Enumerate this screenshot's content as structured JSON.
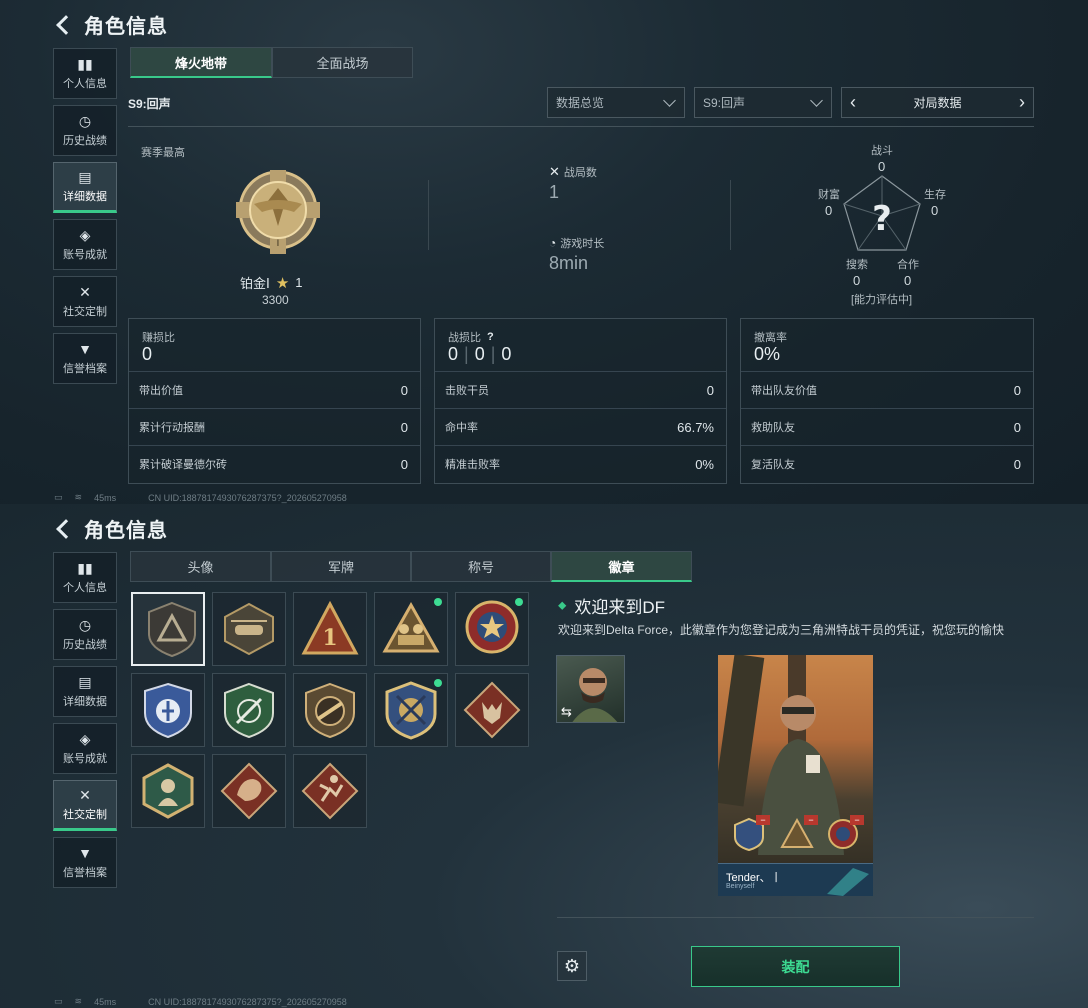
{
  "screen1": {
    "title": "角色信息",
    "sidebar": [
      "个人信息",
      "历史战绩",
      "详细数据",
      "账号成就",
      "社交定制",
      "信誉档案"
    ],
    "tabs": [
      "烽火地带",
      "全面战场"
    ],
    "season_label": "S9:回声",
    "dropdown1": "数据总览",
    "dropdown2": "S9:回声",
    "match_data": "对局数据",
    "rank": {
      "caption": "赛季最高",
      "name": "铂金Ⅰ",
      "stars": "1",
      "score": "3300"
    },
    "battles": {
      "label": "战局数",
      "value": "1"
    },
    "playtime": {
      "label": "游戏时长",
      "value": "8min"
    },
    "radar": {
      "battle": "战斗",
      "battle_v": "0",
      "wealth": "财富",
      "wealth_v": "0",
      "survival": "生存",
      "survival_v": "0",
      "search": "搜索",
      "search_v": "0",
      "coop": "合作",
      "coop_v": "0",
      "note": "[能力评估中]"
    },
    "panel1": {
      "head": "赚损比",
      "head_v": "0",
      "rows": [
        [
          "带出价值",
          "0"
        ],
        [
          "累计行动报酬",
          "0"
        ],
        [
          "累计破译曼德尔砖",
          "0"
        ]
      ]
    },
    "panel2": {
      "head": "战损比",
      "help": "?",
      "v1": "0",
      "v2": "0",
      "v3": "0",
      "rows": [
        [
          "击败干员",
          "0"
        ],
        [
          "命中率",
          "66.7%"
        ],
        [
          "精准击败率",
          "0%"
        ]
      ]
    },
    "panel3": {
      "head": "撤离率",
      "head_v": "0%",
      "rows": [
        [
          "带出队友价值",
          "0"
        ],
        [
          "救助队友",
          "0"
        ],
        [
          "复活队友",
          "0"
        ]
      ]
    },
    "ping": "45ms",
    "uid": "CN UID:1887817493076287375?_202605270958"
  },
  "screen2": {
    "title": "角色信息",
    "sidebar": [
      "个人信息",
      "历史战绩",
      "详细数据",
      "账号成就",
      "社交定制",
      "信誉档案"
    ],
    "tabs": [
      "头像",
      "军牌",
      "称号",
      "徽章"
    ],
    "badge_title": "欢迎来到DF",
    "badge_desc": "欢迎来到Delta Force，此徽章作为您登记成为三角洲特战干员的凭证，祝您玩的愉快",
    "card_name": "Tender、丨",
    "card_sub": "Beinyself",
    "equip": "装配",
    "ping": "45ms",
    "uid": "CN UID:1887817493076287375?_202605270958"
  }
}
